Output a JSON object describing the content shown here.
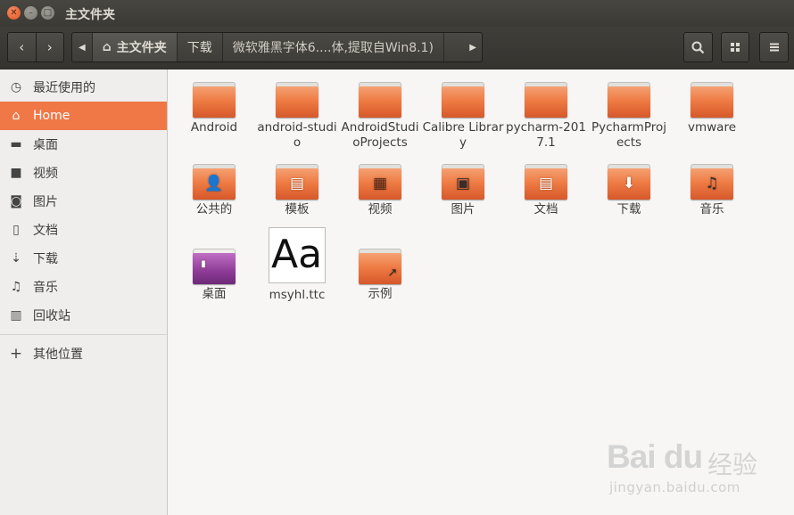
{
  "window": {
    "title": "主文件夹"
  },
  "toolbar": {
    "back_icon": "chevron-left-icon",
    "forward_icon": "chevron-right-icon",
    "path": [
      {
        "label": "主文件夹",
        "icon": "home-icon"
      },
      {
        "label": "下载"
      },
      {
        "label": "微软雅黑字体6....体,提取自Win8.1)"
      }
    ],
    "search_icon": "search-icon",
    "view_icon": "grid-view-icon",
    "menu_icon": "hamburger-menu-icon"
  },
  "sidebar": {
    "items": [
      {
        "label": "最近使用的",
        "icon": "clock-icon"
      },
      {
        "label": "Home",
        "icon": "home-icon",
        "active": true
      },
      {
        "label": "桌面",
        "icon": "folder-icon"
      },
      {
        "label": "视频",
        "icon": "video-icon"
      },
      {
        "label": "图片",
        "icon": "camera-icon"
      },
      {
        "label": "文档",
        "icon": "document-icon"
      },
      {
        "label": "下载",
        "icon": "download-icon"
      },
      {
        "label": "音乐",
        "icon": "music-icon"
      },
      {
        "label": "回收站",
        "icon": "trash-icon"
      }
    ],
    "other": {
      "label": "其他位置",
      "icon": "plus-icon"
    }
  },
  "files": [
    {
      "name": "Android",
      "type": "folder"
    },
    {
      "name": "android-studio",
      "type": "folder"
    },
    {
      "name": "AndroidStudioProjects",
      "type": "folder"
    },
    {
      "name": "Calibre Library",
      "type": "folder"
    },
    {
      "name": "pycharm-2017.1",
      "type": "folder"
    },
    {
      "name": "PycharmProjects",
      "type": "folder"
    },
    {
      "name": "vmware",
      "type": "folder"
    },
    {
      "name": "公共的",
      "type": "folder",
      "emblem": "person-icon"
    },
    {
      "name": "模板",
      "type": "folder",
      "emblem": "template-icon"
    },
    {
      "name": "视频",
      "type": "folder",
      "emblem": "film-icon"
    },
    {
      "name": "图片",
      "type": "folder",
      "emblem": "picture-icon"
    },
    {
      "name": "文档",
      "type": "folder",
      "emblem": "document-icon"
    },
    {
      "name": "下载",
      "type": "folder",
      "emblem": "download-arrow-icon"
    },
    {
      "name": "音乐",
      "type": "folder",
      "emblem": "music-note-icon"
    },
    {
      "name": "桌面",
      "type": "folder",
      "emblem": "desktop-icon",
      "color": "#8c3b95"
    },
    {
      "name": "msyhl.ttc",
      "type": "font",
      "preview": "Aa"
    },
    {
      "name": "示例",
      "type": "folder",
      "emblem": "link-arrow-icon"
    }
  ],
  "watermark": {
    "logo": "Bai du",
    "text": "经验",
    "url": "jingyan.baidu.com"
  },
  "colors": {
    "accent": "#f07746",
    "titlebar": "#3c3b37",
    "folder": "#ef7c45"
  }
}
